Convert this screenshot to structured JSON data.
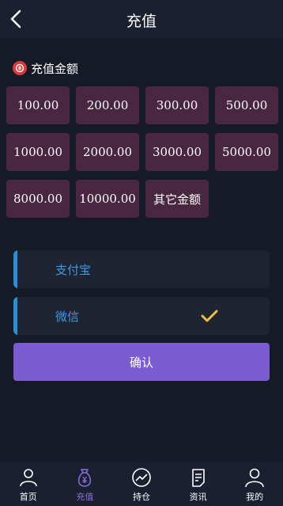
{
  "header": {
    "title": "充值"
  },
  "section": {
    "label": "充值金额"
  },
  "amounts": [
    "100.00",
    "200.00",
    "300.00",
    "500.00",
    "1000.00",
    "2000.00",
    "3000.00",
    "5000.00",
    "8000.00",
    "10000.00",
    "其它金额"
  ],
  "payment": {
    "methods": [
      {
        "label": "支付宝",
        "selected": false
      },
      {
        "label": "微信",
        "selected": true
      }
    ]
  },
  "confirm_label": "确认",
  "tabbar": {
    "items": [
      {
        "label": "首页",
        "icon": "person-icon",
        "active": false
      },
      {
        "label": "充值",
        "icon": "money-bag-icon",
        "active": true
      },
      {
        "label": "持仓",
        "icon": "chart-trend-icon",
        "active": false
      },
      {
        "label": "资讯",
        "icon": "news-icon",
        "active": false
      },
      {
        "label": "我的",
        "icon": "user-icon",
        "active": false
      }
    ]
  },
  "colors": {
    "background": "#161a26",
    "amount_tile": "#4a2740",
    "accent_blue": "#2a8fd6",
    "confirm": "#7a5bd0",
    "check": "#f0c040",
    "active_tab": "#8b6fe0"
  }
}
